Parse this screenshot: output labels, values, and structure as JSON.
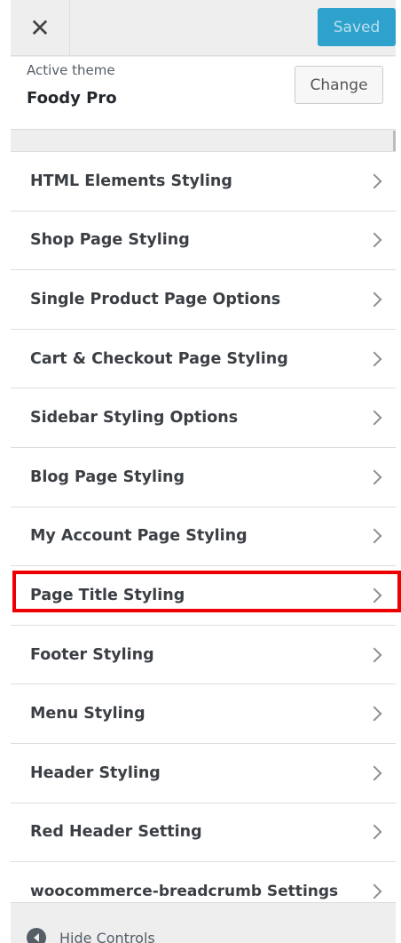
{
  "header": {
    "close_symbol": "✕",
    "saved_label": "Saved"
  },
  "theme": {
    "label": "Active theme",
    "name": "Foody Pro",
    "change_label": "Change"
  },
  "menu": {
    "items": [
      {
        "label": "HTML Elements Styling"
      },
      {
        "label": "Shop Page Styling"
      },
      {
        "label": "Single Product Page Options"
      },
      {
        "label": "Cart & Checkout Page Styling"
      },
      {
        "label": "Sidebar Styling Options"
      },
      {
        "label": "Blog Page Styling"
      },
      {
        "label": "My Account Page Styling"
      },
      {
        "label": "Page Title Styling"
      },
      {
        "label": "Footer Styling"
      },
      {
        "label": "Menu Styling"
      },
      {
        "label": "Header Styling"
      },
      {
        "label": "Red Header Setting"
      },
      {
        "label": "woocommerce-breadcrumb Settings"
      }
    ]
  },
  "footer": {
    "hide_label": "Hide Controls"
  },
  "colors": {
    "accent": "#2ea2cc",
    "highlight": "#ee0000"
  }
}
